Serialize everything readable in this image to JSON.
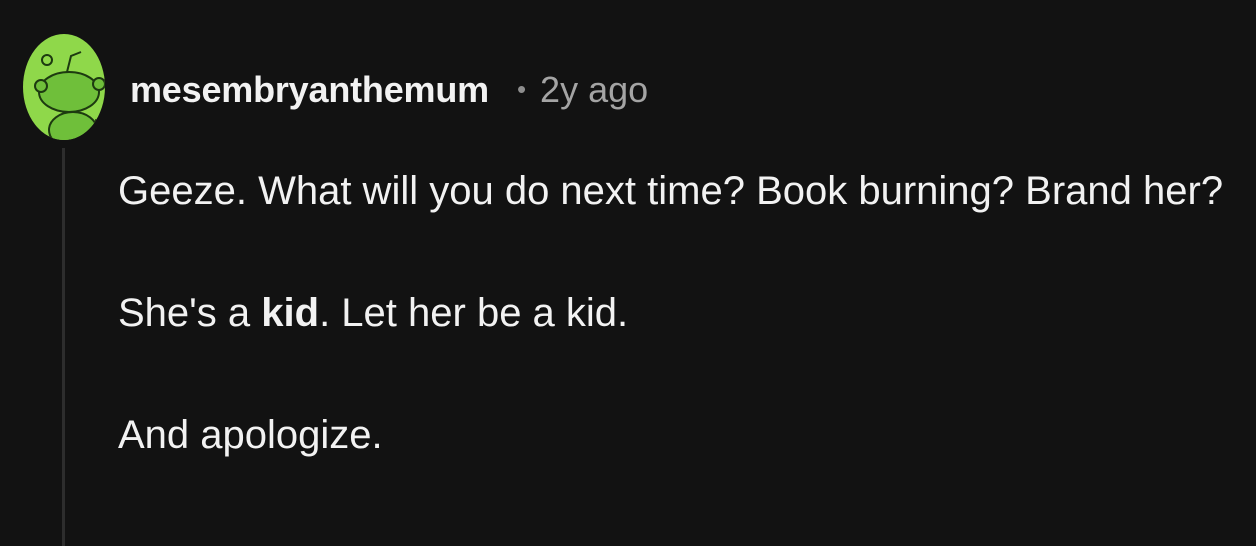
{
  "comment": {
    "avatar_icon": "snoo-avatar-icon",
    "avatar_color": "#8fd84a",
    "username": "mesembryanthemum",
    "separator": "•",
    "age": "2y ago",
    "paragraphs": {
      "p1": "Geeze. What will you do next time? Book burning? Brand her?",
      "p2": {
        "before": "She's a ",
        "bold": "kid",
        "after": ". Let her be a kid."
      },
      "p3": "And apologize."
    }
  }
}
